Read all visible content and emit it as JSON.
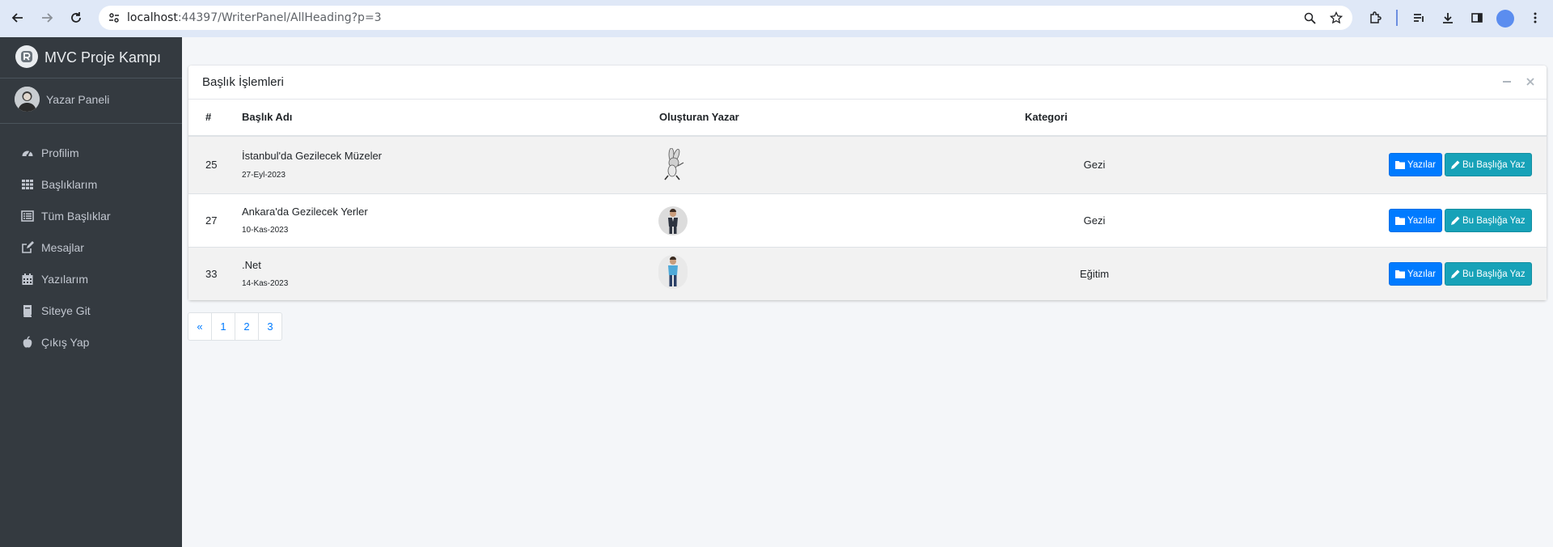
{
  "browser": {
    "url_host": "localhost",
    "url_rest": ":44397/WriterPanel/AllHeading?p=3"
  },
  "sidebar": {
    "brand": "MVC Proje Kampı",
    "user": "Yazar Paneli",
    "items": [
      {
        "label": "Profilim",
        "icon": "dashboard-gauge-icon"
      },
      {
        "label": "Başlıklarım",
        "icon": "grid-icon"
      },
      {
        "label": "Tüm Başlıklar",
        "icon": "list-icon"
      },
      {
        "label": "Mesajlar",
        "icon": "edit-icon"
      },
      {
        "label": "Yazılarım",
        "icon": "calendar-icon"
      },
      {
        "label": "Siteye Git",
        "icon": "book-icon"
      },
      {
        "label": "Çıkış Yap",
        "icon": "apple-icon"
      }
    ]
  },
  "card": {
    "title": "Başlık İşlemleri",
    "columns": [
      "#",
      "Başlık Adı",
      "Oluşturan Yazar",
      "Kategori"
    ],
    "rows": [
      {
        "id": "25",
        "title": "İstanbul'da Gezilecek Müzeler",
        "date": "27-Eyl-2023",
        "category": "Gezi",
        "avatar": "cartoon-rabbit"
      },
      {
        "id": "27",
        "title": "Ankara'da Gezilecek Yerler",
        "date": "10-Kas-2023",
        "category": "Gezi",
        "avatar": "man-in-suit"
      },
      {
        "id": "33",
        "title": ".Net",
        "date": "14-Kas-2023",
        "category": "Eğitim",
        "avatar": "man-in-blue-shirt"
      }
    ],
    "btn_posts": "Yazılar",
    "btn_write": "Bu Başlığa Yaz"
  },
  "pagination": [
    "«",
    "1",
    "2",
    "3"
  ],
  "colors": {
    "sidebar_bg": "#343a40",
    "primary": "#007bff",
    "info": "#17a2b8",
    "page_bg": "#f4f6f9"
  }
}
